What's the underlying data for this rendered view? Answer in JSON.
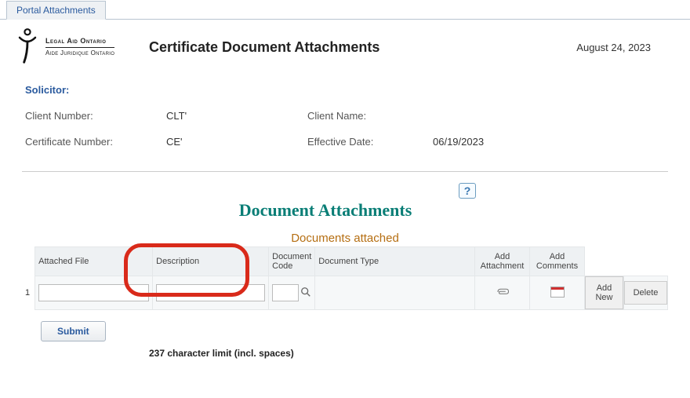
{
  "tab": {
    "label": "Portal Attachments"
  },
  "header": {
    "logo": {
      "en": "Legal Aid Ontario",
      "fr": "Aide Juridique Ontario"
    },
    "title": "Certificate Document Attachments",
    "date": "August 24, 2023"
  },
  "info": {
    "solicitor_label": "Solicitor:",
    "client_number_label": "Client Number:",
    "client_number_value": "CLT'",
    "client_name_label": "Client Name:",
    "client_name_value": "",
    "cert_number_label": "Certificate Number:",
    "cert_number_value": "CE'",
    "eff_date_label": "Effective Date:",
    "eff_date_value": "06/19/2023"
  },
  "help": {
    "glyph": "?"
  },
  "section": {
    "title": "Document Attachments"
  },
  "table": {
    "caption": "Documents attached",
    "headers": {
      "attached_file": "Attached File",
      "description": "Description",
      "document_code": "Document Code",
      "document_type": "Document Type",
      "add_attachment": "Add Attachment",
      "add_comments": "Add Comments"
    },
    "row": {
      "index": "1",
      "attached_file": "",
      "description": "",
      "document_code": "",
      "document_type": ""
    },
    "actions": {
      "add_new": "Add New",
      "delete": "Delete"
    }
  },
  "submit": {
    "label": "Submit"
  },
  "footer_note": "237 character limit (incl. spaces)"
}
